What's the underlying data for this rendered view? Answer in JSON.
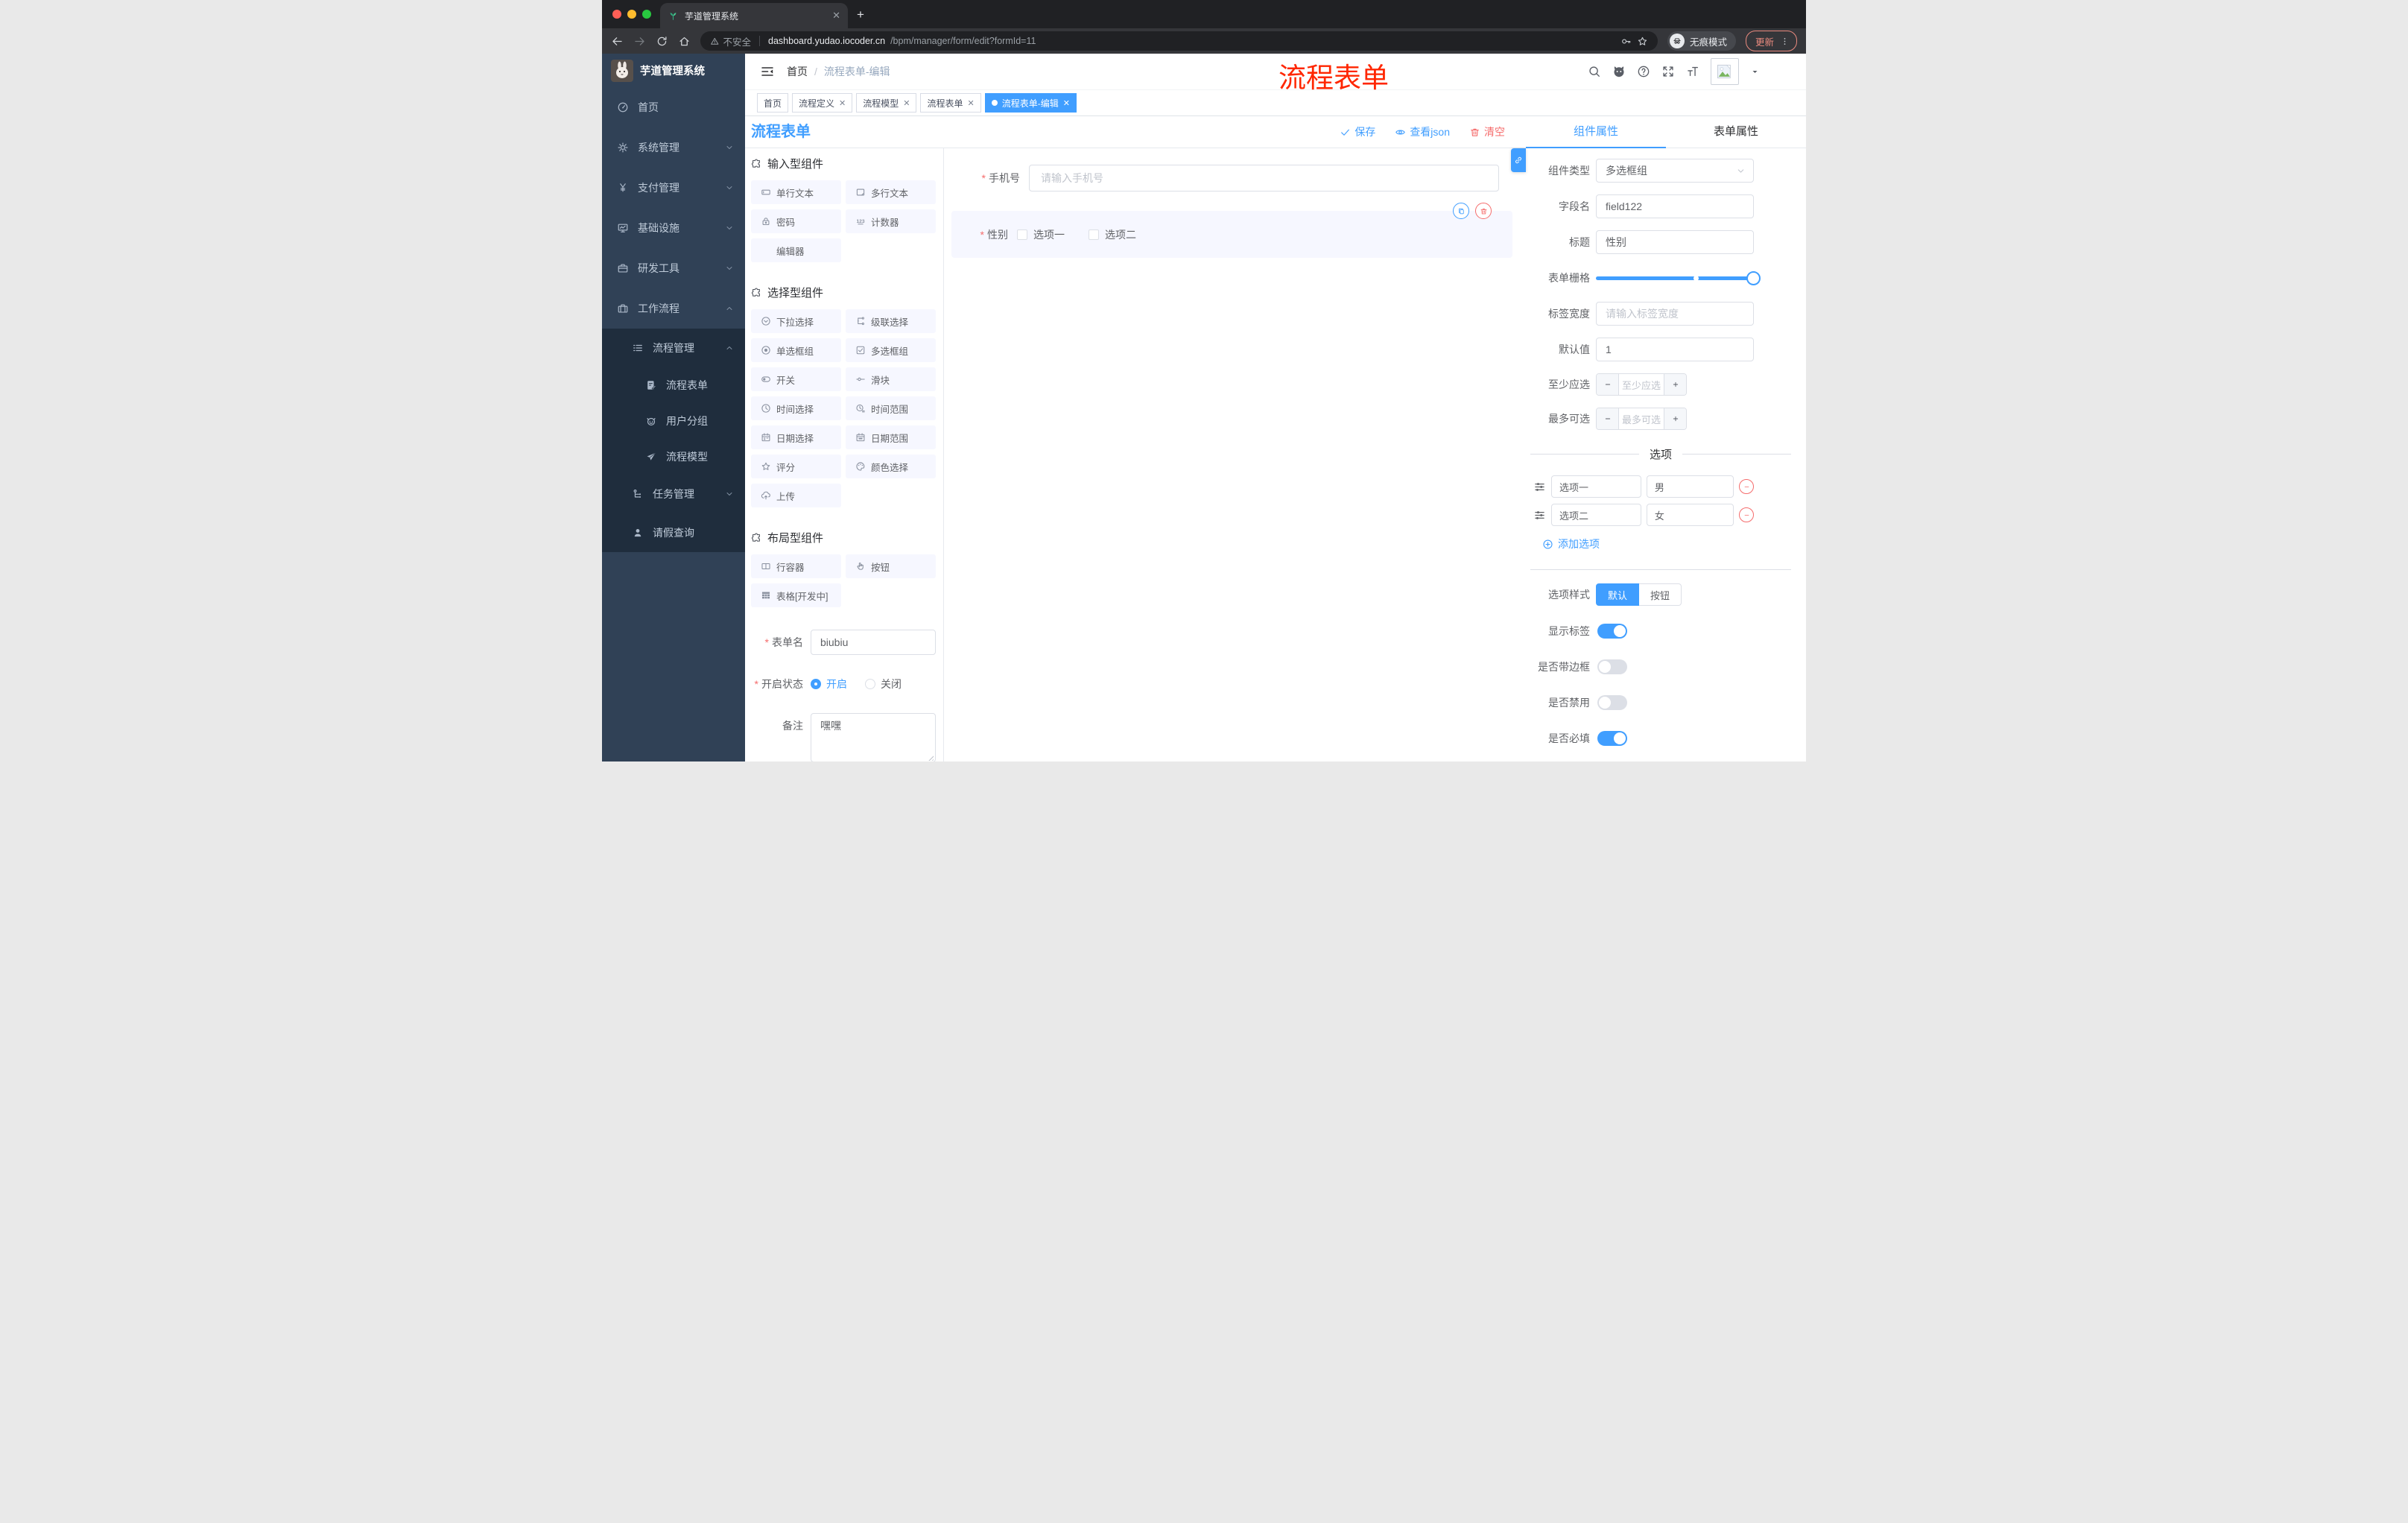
{
  "browser": {
    "tab_title": "芋道管理系统",
    "security_label": "不安全",
    "url_host": "dashboard.yudao.iocoder.cn",
    "url_path": "/bpm/manager/form/edit?formId=11",
    "incognito_label": "无痕模式",
    "update_label": "更新"
  },
  "sidebar": {
    "logo_title": "芋道管理系统",
    "items": [
      {
        "key": "home",
        "label": "首页",
        "icon": "dashboard",
        "level": 1
      },
      {
        "key": "system",
        "label": "系统管理",
        "icon": "gear",
        "level": 1,
        "chevron": "down"
      },
      {
        "key": "payment",
        "label": "支付管理",
        "icon": "yen",
        "level": 1,
        "chevron": "down"
      },
      {
        "key": "infra",
        "label": "基础设施",
        "icon": "monitor",
        "level": 1,
        "chevron": "down"
      },
      {
        "key": "dev-tools",
        "label": "研发工具",
        "icon": "briefcase",
        "level": 1,
        "chevron": "down"
      },
      {
        "key": "workflow",
        "label": "工作流程",
        "icon": "suitcase",
        "level": 1,
        "chevron": "up"
      },
      {
        "key": "process-mgmt",
        "label": "流程管理",
        "icon": "list",
        "level": 2,
        "chevron": "up",
        "dark": true
      },
      {
        "key": "process-form",
        "label": "流程表单",
        "icon": "doc-edit",
        "level": 3,
        "dark": true
      },
      {
        "key": "user-group",
        "label": "用户分组",
        "icon": "robot",
        "level": 3,
        "dark": true
      },
      {
        "key": "process-model",
        "label": "流程模型",
        "icon": "send",
        "level": 3,
        "dark": true
      },
      {
        "key": "task-mgmt",
        "label": "任务管理",
        "icon": "tree",
        "level": 2,
        "chevron": "down",
        "dark": true
      },
      {
        "key": "leave-query",
        "label": "请假查询",
        "icon": "user",
        "level": 2,
        "dark": true
      }
    ]
  },
  "navbar": {
    "breadcrumb_home": "首页",
    "breadcrumb_current": "流程表单-编辑",
    "overlay_title": "流程表单"
  },
  "tags": [
    {
      "key": "home",
      "label": "首页",
      "closable": false,
      "active": false
    },
    {
      "key": "process-definition",
      "label": "流程定义",
      "closable": true,
      "active": false
    },
    {
      "key": "process-model",
      "label": "流程模型",
      "closable": true,
      "active": false
    },
    {
      "key": "process-form",
      "label": "流程表单",
      "closable": true,
      "active": false
    },
    {
      "key": "process-form-edit",
      "label": "流程表单-编辑",
      "closable": true,
      "active": true
    }
  ],
  "builder": {
    "panel_title": "流程表单",
    "actions": [
      {
        "key": "save",
        "label": "保存",
        "icon": "check",
        "color": "blue"
      },
      {
        "key": "view-json",
        "label": "查看json",
        "icon": "eye",
        "color": "blue"
      },
      {
        "key": "clear",
        "label": "清空",
        "icon": "trash",
        "color": "red"
      }
    ]
  },
  "palette": {
    "sections": [
      {
        "title": "输入型组件",
        "items": [
          {
            "key": "single-line-text",
            "label": "单行文本",
            "icon": "input"
          },
          {
            "key": "multi-line-text",
            "label": "多行文本",
            "icon": "textarea"
          },
          {
            "key": "password",
            "label": "密码",
            "icon": "lock"
          },
          {
            "key": "counter",
            "label": "计数器",
            "icon": "counter"
          },
          {
            "key": "editor",
            "label": "编辑器",
            "icon": ""
          }
        ]
      },
      {
        "title": "选择型组件",
        "items": [
          {
            "key": "select",
            "label": "下拉选择",
            "icon": "select"
          },
          {
            "key": "cascader",
            "label": "级联选择",
            "icon": "cascade"
          },
          {
            "key": "radio-group",
            "label": "单选框组",
            "icon": "radio"
          },
          {
            "key": "checkbox-group",
            "label": "多选框组",
            "icon": "checkbox"
          },
          {
            "key": "switch",
            "label": "开关",
            "icon": "switch"
          },
          {
            "key": "slider",
            "label": "滑块",
            "icon": "slider"
          },
          {
            "key": "time-picker",
            "label": "时间选择",
            "icon": "time"
          },
          {
            "key": "time-range",
            "label": "时间范围",
            "icon": "time-range"
          },
          {
            "key": "date-picker",
            "label": "日期选择",
            "icon": "date"
          },
          {
            "key": "date-range",
            "label": "日期范围",
            "icon": "date-range"
          },
          {
            "key": "rate",
            "label": "评分",
            "icon": "star"
          },
          {
            "key": "color-picker",
            "label": "颜色选择",
            "icon": "color"
          },
          {
            "key": "upload",
            "label": "上传",
            "icon": "upload"
          }
        ]
      },
      {
        "title": "布局型组件",
        "items": [
          {
            "key": "row-container",
            "label": "行容器",
            "icon": "row"
          },
          {
            "key": "button",
            "label": "按钮",
            "icon": "hand"
          },
          {
            "key": "table-dev",
            "label": "表格[开发中]",
            "icon": "table"
          }
        ]
      }
    ],
    "form": {
      "name_label": "表单名",
      "name_value": "biubiu",
      "status_label": "开启状态",
      "status_on": "开启",
      "status_off": "关闭",
      "remark_label": "备注",
      "remark_value": "嘿嘿"
    }
  },
  "canvas": {
    "phone": {
      "label": "手机号",
      "placeholder": "请输入手机号"
    },
    "gender": {
      "label": "性别",
      "options": [
        "选项一",
        "选项二"
      ]
    }
  },
  "inspector": {
    "tabs": [
      {
        "key": "component-props",
        "label": "组件属性",
        "active": true
      },
      {
        "key": "form-props",
        "label": "表单属性",
        "active": false
      }
    ],
    "component_type_label": "组件类型",
    "component_type_value": "多选框组",
    "field_name_label": "字段名",
    "field_name_value": "field122",
    "title_label": "标题",
    "title_value": "性别",
    "grid_label": "表单栅格",
    "label_width_label": "标签宽度",
    "label_width_placeholder": "请输入标签宽度",
    "default_label": "默认值",
    "default_value": "1",
    "min_label": "至少应选",
    "min_placeholder": "至少应选",
    "max_label": "最多可选",
    "max_placeholder": "最多可选",
    "options_title": "选项",
    "options": [
      {
        "name": "选项一",
        "value": "男"
      },
      {
        "name": "选项二",
        "value": "女"
      }
    ],
    "add_option_label": "添加选项",
    "style_label": "选项样式",
    "style_options": [
      {
        "key": "default",
        "label": "默认",
        "active": true
      },
      {
        "key": "button",
        "label": "按钮",
        "active": false
      }
    ],
    "switches": [
      {
        "key": "show-label",
        "label": "显示标签",
        "on": true
      },
      {
        "key": "with-border",
        "label": "是否带边框",
        "on": false
      },
      {
        "key": "disabled",
        "label": "是否禁用",
        "on": false
      },
      {
        "key": "required",
        "label": "是否必填",
        "on": true
      }
    ]
  },
  "colors": {
    "primary": "#409eff",
    "danger": "#f56c6c",
    "sidebar_bg": "#304156",
    "submenu_bg": "#1f2d3d",
    "annotation_red": "#ff2600"
  }
}
